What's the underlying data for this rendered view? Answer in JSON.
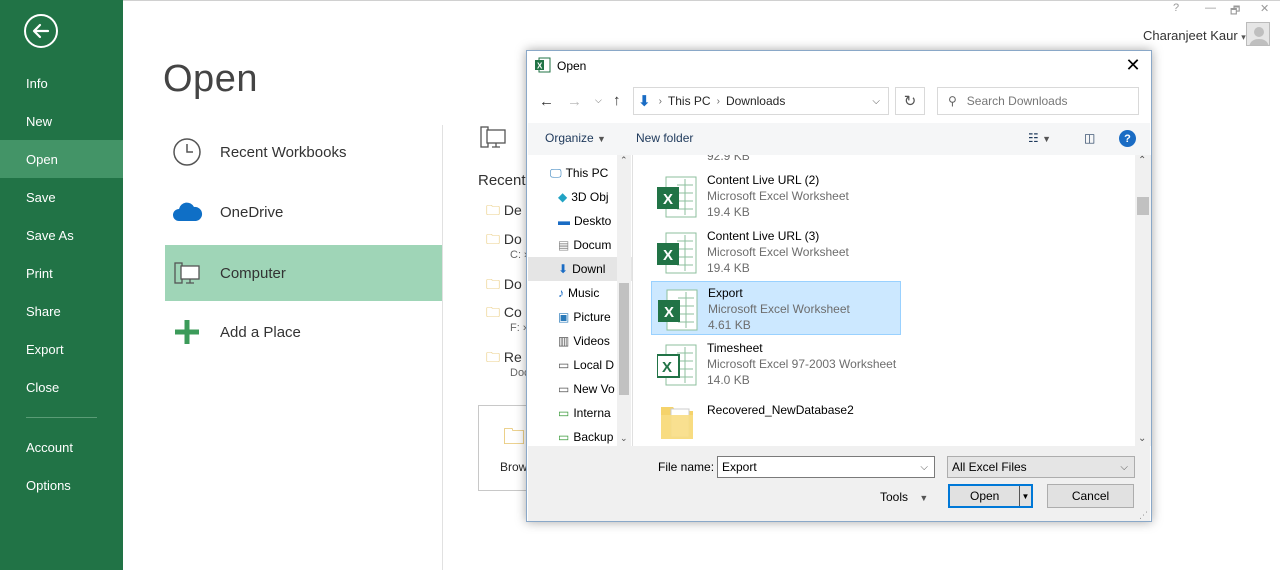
{
  "backstage": {
    "nav": [
      "Info",
      "New",
      "Open",
      "Save",
      "Save As",
      "Print",
      "Share",
      "Export",
      "Close",
      "Account",
      "Options"
    ],
    "active": "Open"
  },
  "page_title": "Open",
  "locations": [
    "Recent Workbooks",
    "OneDrive",
    "Computer",
    "Add a Place"
  ],
  "recent": {
    "heading": "Recent",
    "rows": [
      {
        "name": "De",
        "sub": ""
      },
      {
        "name": "Do",
        "sub": "C: »"
      },
      {
        "name": "Do",
        "sub": ""
      },
      {
        "name": "Co",
        "sub": "F: »"
      },
      {
        "name": "Re",
        "sub": "Doc"
      }
    ],
    "browse_label": "Brow"
  },
  "user": {
    "name": "Charanjeet Kaur"
  },
  "window_controls": [
    "?",
    "—",
    "🗗",
    "✕"
  ],
  "dialog": {
    "title": "Open",
    "breadcrumb": [
      "This PC",
      "Downloads"
    ],
    "search_placeholder": "Search Downloads",
    "toolbar": {
      "organize": "Organize",
      "new_folder": "New folder"
    },
    "tree": [
      "This PC",
      "3D Obj",
      "Deskto",
      "Docum",
      "Downl",
      "Music",
      "Picture",
      "Videos",
      "Local D",
      "New Vo",
      "Interna",
      "Backup"
    ],
    "tree_selected": "Downl",
    "top_partial": "92.9 KB",
    "files": [
      {
        "name": "Content Live URL (2)",
        "type": "Microsoft Excel Worksheet",
        "size": "19.4 KB"
      },
      {
        "name": "Content Live URL (3)",
        "type": "Microsoft Excel Worksheet",
        "size": "19.4 KB"
      },
      {
        "name": "Export",
        "type": "Microsoft Excel Worksheet",
        "size": "4.61 KB"
      },
      {
        "name": "Timesheet",
        "type": "Microsoft Excel 97-2003 Worksheet",
        "size": "14.0 KB"
      },
      {
        "name": "Recovered_NewDatabase2",
        "type": "",
        "size": ""
      }
    ],
    "selected_file": "Export",
    "file_name_label": "File name:",
    "file_name_value": "Export",
    "file_type": "All Excel Files",
    "tools_label": "Tools",
    "open_label": "Open",
    "cancel_label": "Cancel"
  },
  "colors": {
    "excel_green": "#217346",
    "active_nav": "#439467",
    "selected_location": "#9fd5b7",
    "selected_file": "#cce8ff"
  }
}
